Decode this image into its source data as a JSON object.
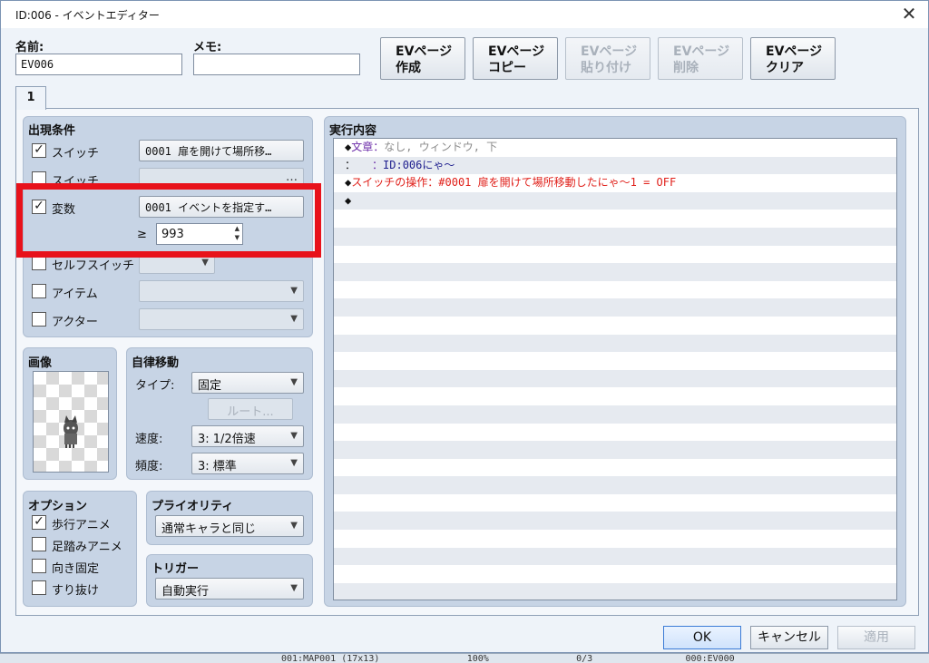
{
  "window": {
    "title": "ID:006 - イベントエディター"
  },
  "header": {
    "name_label": "名前:",
    "name_value": "EV006",
    "memo_label": "メモ:",
    "memo_value": "",
    "buttons": [
      {
        "line1": "EVページ",
        "line2": "作成",
        "enabled": true
      },
      {
        "line1": "EVページ",
        "line2": "コピー",
        "enabled": true
      },
      {
        "line1": "EVページ",
        "line2": "貼り付け",
        "enabled": false
      },
      {
        "line1": "EVページ",
        "line2": "削除",
        "enabled": false
      },
      {
        "line1": "EVページ",
        "line2": "クリア",
        "enabled": true
      }
    ]
  },
  "tabs": [
    {
      "label": "1"
    }
  ],
  "conditions": {
    "title": "出現条件",
    "switch1": {
      "label": "スイッチ",
      "checked": true,
      "value": "0001 扉を開けて場所移…"
    },
    "switch2": {
      "label": "スイッチ",
      "checked": false,
      "value": ""
    },
    "variable": {
      "label": "変数",
      "checked": true,
      "value": "0001 イベントを指定す…",
      "operator": "≥",
      "number": "993"
    },
    "self_switch": {
      "label": "セルフスイッチ",
      "checked": false
    },
    "item": {
      "label": "アイテム",
      "checked": false
    },
    "actor": {
      "label": "アクター",
      "checked": false
    }
  },
  "image": {
    "title": "画像"
  },
  "autonomous": {
    "title": "自律移動",
    "type_label": "タイプ:",
    "type_value": "固定",
    "route_button": "ルート...",
    "speed_label": "速度:",
    "speed_value": "3: 1/2倍速",
    "freq_label": "頻度:",
    "freq_value": "3: 標準"
  },
  "options": {
    "title": "オプション",
    "items": [
      {
        "label": "歩行アニメ",
        "checked": true
      },
      {
        "label": "足踏みアニメ",
        "checked": false
      },
      {
        "label": "向き固定",
        "checked": false
      },
      {
        "label": "すり抜け",
        "checked": false
      }
    ]
  },
  "priority": {
    "title": "プライオリティ",
    "value": "通常キャラと同じ"
  },
  "trigger": {
    "title": "トリガー",
    "value": "自動実行"
  },
  "contents": {
    "title": "実行内容",
    "lines": [
      {
        "prefix": "◆",
        "cmd": "文章",
        "sep": "：",
        "text": "なし, ウィンドウ, 下"
      },
      {
        "prefix": "：",
        "cmd": "",
        "sep": "　　：",
        "text": "ID:006にゃ～"
      },
      {
        "prefix": "◆",
        "cmd": "スイッチの操作",
        "sep": "：",
        "text": "#0001 扉を開けて場所移動したにゃ～1 = OFF"
      },
      {
        "prefix": "◆",
        "cmd": "",
        "sep": "",
        "text": ""
      }
    ]
  },
  "footer": {
    "ok": "OK",
    "cancel": "キャンセル",
    "apply": "適用"
  },
  "background_strip": "001:MAP001 (17x13)                100%                0/3                 000:EV000",
  "colors": {
    "highlight": "#e8121b",
    "accent": "#3b7bd6"
  }
}
